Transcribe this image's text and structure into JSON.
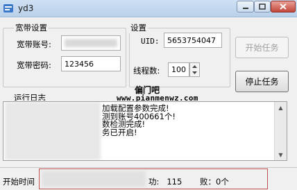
{
  "window": {
    "title": "yd3"
  },
  "broadband": {
    "group_label": "宽带设置",
    "account_label": "宽带账号:",
    "account_value": "",
    "password_label": "宽带密码:",
    "password_value": "123456"
  },
  "settings": {
    "group_label": "设置",
    "uid_label": "UID:",
    "uid_value": "5653754047",
    "threads_label": "线程数:",
    "threads_value": "100"
  },
  "buttons": {
    "start": "开始任务",
    "stop": "停止任务"
  },
  "watermark": {
    "title": "偏门吧",
    "url": "www.pianmenwz.com"
  },
  "log": {
    "label": "运行日志",
    "lines": [
      "加载配置参数完成!",
      "测到账号400661个!",
      "数检测完成!",
      "务已开启!"
    ]
  },
  "status": {
    "start_time_label": "开始时间",
    "success_text": "功:   115",
    "fail_text": "败：0个"
  }
}
